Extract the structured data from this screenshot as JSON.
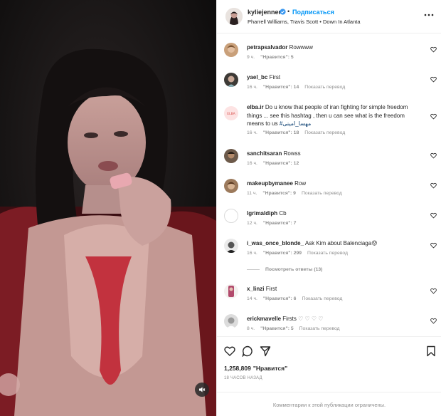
{
  "post": {
    "username": "kyliejenner",
    "separator": "•",
    "follow_label": "Подписаться",
    "audio": "Pharrell Williams, Travis Scott • Down In Atlanta"
  },
  "comments": [
    {
      "user": "petrapsalvador",
      "text": "Rowwww",
      "time": "9 ч.",
      "likes": "\"Нравится\": 5",
      "reply": ""
    },
    {
      "user": "yael_bc",
      "text": "First",
      "time": "16 ч.",
      "likes": "\"Нравится\": 14",
      "reply": "Показать перевод"
    },
    {
      "user": "elba.ir",
      "text": "Do u know that people of iran fighting for simple freedom things ... see this hashtag , then u can see what is the freedom means to us",
      "hashtag": "#مهسا_امینی",
      "time": "16 ч.",
      "likes": "\"Нравится\": 18",
      "reply": "Показать перевод",
      "avatar_text": "ELBA"
    },
    {
      "user": "sanchitsaran",
      "text": "Rowss",
      "time": "16 ч.",
      "likes": "\"Нравится\": 12",
      "reply": ""
    },
    {
      "user": "makeupbymanee",
      "text": "Row",
      "time": "11 ч.",
      "likes": "\"Нравится\": 9",
      "reply": "Показать перевод"
    },
    {
      "user": "lgrimaldiph",
      "text": "Cb",
      "time": "12 ч.",
      "likes": "\"Нравится\": 7",
      "reply": ""
    },
    {
      "user": "i_was_once_blonde_",
      "text": "Ask Kim about Balenciaga",
      "emoji": "😡",
      "time": "16 ч.",
      "likes": "\"Нравится\": 299",
      "reply": "Показать перевод"
    },
    {
      "user": "x_linzi",
      "text": "First",
      "time": "14 ч.",
      "likes": "\"Нравится\": 6",
      "reply": "Показать перевод"
    },
    {
      "user": "erickmavelle",
      "text": "Firsts",
      "emoji": "♡ ♡ ♡ ♡",
      "time": "8 ч.",
      "likes": "\"Нравится\": 5",
      "reply": "Показать перевод"
    }
  ],
  "view_replies": "Посмотреть ответы (13)",
  "likes_count": "1,258,809",
  "likes_label": "\"Нравится\"",
  "posted_time": "18 ЧАСОВ НАЗАД",
  "footer_text": "Комментарии к этой публикации ограничены.",
  "icons": [
    "more-icon",
    "heart-icon",
    "comment-icon",
    "share-icon",
    "bookmark-icon",
    "mute-icon",
    "verified-icon"
  ],
  "colors": {
    "link": "#0095f6",
    "muted": "#8e8e8e",
    "text": "#262626",
    "border": "#efefef"
  }
}
